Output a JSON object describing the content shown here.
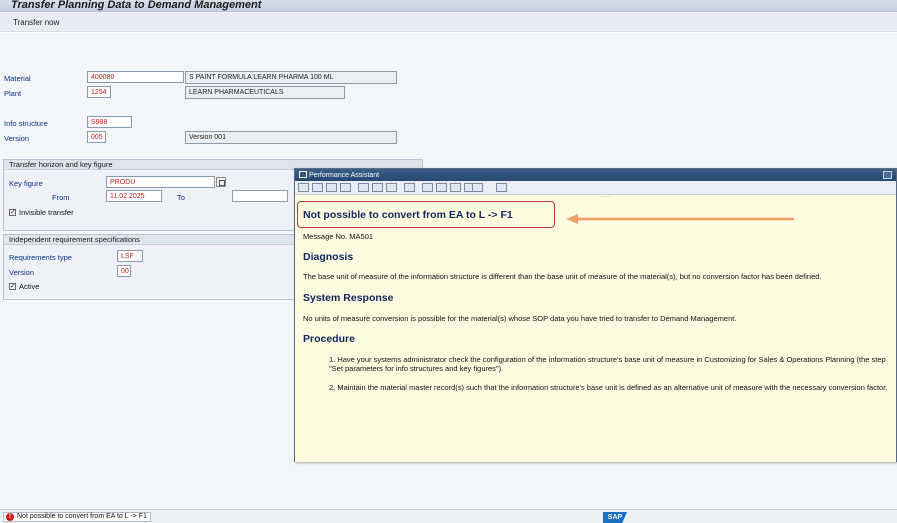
{
  "window": {
    "title": "Transfer Planning Data to Demand Management"
  },
  "toolbar": {
    "transfer_now": "Transfer now"
  },
  "form": {
    "material": {
      "label": "Material",
      "value": "400080",
      "description": "S PAINT FORMULA LEARN PHARMA 100 ML"
    },
    "plant": {
      "label": "Plant",
      "value": "1254",
      "description": "LEARN PHARMACEUTICALS"
    },
    "info_structure": {
      "label": "Info structure",
      "value": "S988"
    },
    "version": {
      "label": "Version",
      "value": "005",
      "description": "Version 001"
    }
  },
  "transfer_group": {
    "title": "Transfer horizon and key figure",
    "key_figure_label": "Key figure",
    "key_figure_value": "PRODU",
    "from_label": "From",
    "from_value": "11.02.2025",
    "to_label": "To",
    "to_value": "",
    "invisible_transfer_label": "Invisible transfer",
    "invisible_transfer_checked": "✓"
  },
  "indep_group": {
    "title": "Independent requirement specifications",
    "req_type_label": "Requirements type",
    "req_type_value": "LSF",
    "version_label": "Version",
    "version_value": "00",
    "active_label": "Active",
    "active_checked": "✓"
  },
  "performance_assistant": {
    "title": "Performance Assistant",
    "separator": ".....",
    "message_title": "Not possible to convert from EA to L -> F1",
    "message_no": "Message No. MA501",
    "diagnosis_heading": "Diagnosis",
    "diagnosis_text": "The base unit of measure of the information structure is different than the base unit of measure of the material(s), but no conversion factor has been defined.",
    "system_response_heading": "System Response",
    "system_response_text": "No units of measure conversion is possible for the material(s) whose SOP data you have tried to transfer to Demand Management.",
    "procedure_heading": "Procedure",
    "procedure_step1": "1. Have your systems administrator check the configuration of the information structure's base unit of measure in Customizing for Sales & Operations Planning (the step \"Set parameters for info structures and key figures\").",
    "procedure_step2": "2. Maintain the material master record(s) such that the information structure's base unit is defined as an alternative unit of measure with the necessary conversion factor."
  },
  "status_bar": {
    "message": "Not possible to convert from EA to L -> F1",
    "error_glyph": "!",
    "sap_logo": "SAP"
  },
  "colors": {
    "annotation_arrow": "#f0a060",
    "highlight_box": "#b4393a",
    "label_blue": "#0a2e8c"
  }
}
